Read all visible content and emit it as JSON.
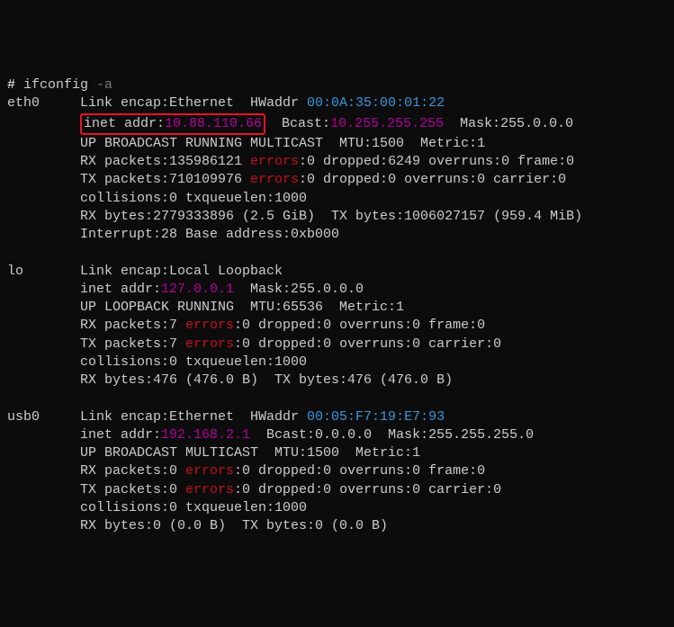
{
  "prompt": "# ",
  "command": "ifconfig",
  "command_arg": " -a",
  "eth0": {
    "name": "eth0",
    "link_prefix": "Link encap:Ethernet  HWaddr ",
    "hwaddr": "00:0A:35:00:01:22",
    "inet_label": "inet addr:",
    "inet": "10.88.110.66",
    "bcast_label": "  Bcast:",
    "bcast": "10.255.255.255",
    "mask": "  Mask:255.0.0.0",
    "flags": "UP BROADCAST RUNNING MULTICAST  MTU:1500  Metric:1",
    "rx_packets_a": "RX packets:135986121 ",
    "rx_err": "errors",
    "rx_packets_b": ":0 dropped:6249 overruns:0 frame:0",
    "tx_packets_a": "TX packets:710109976 ",
    "tx_err": "errors",
    "tx_packets_b": ":0 dropped:0 overruns:0 carrier:0",
    "collisions": "collisions:0 txqueuelen:1000",
    "bytes": "RX bytes:2779333896 (2.5 GiB)  TX bytes:1006027157 (959.4 MiB)",
    "interrupt": "Interrupt:28 Base address:0xb000"
  },
  "lo": {
    "name": "lo",
    "link_prefix": "Link encap:Local Loopback",
    "inet_label": "inet addr:",
    "inet": "127.0.0.1",
    "mask": "  Mask:255.0.0.0",
    "flags": "UP LOOPBACK RUNNING  MTU:65536  Metric:1",
    "rx_packets_a": "RX packets:7 ",
    "rx_err": "errors",
    "rx_packets_b": ":0 dropped:0 overruns:0 frame:0",
    "tx_packets_a": "TX packets:7 ",
    "tx_err": "errors",
    "tx_packets_b": ":0 dropped:0 overruns:0 carrier:0",
    "collisions": "collisions:0 txqueuelen:1000",
    "bytes": "RX bytes:476 (476.0 B)  TX bytes:476 (476.0 B)"
  },
  "usb0": {
    "name": "usb0",
    "link_prefix": "Link encap:Ethernet  HWaddr ",
    "hwaddr": "00:05:F7:19:E7:93",
    "inet_label": "inet addr:",
    "inet": "192.168.2.1",
    "bcast_label": "  Bcast:0.0.0.0  Mask:255.255.255.0",
    "flags": "UP BROADCAST MULTICAST  MTU:1500  Metric:1",
    "rx_packets_a": "RX packets:0 ",
    "rx_err": "errors",
    "rx_packets_b": ":0 dropped:0 overruns:0 frame:0",
    "tx_packets_a": "TX packets:0 ",
    "tx_err": "errors",
    "tx_packets_b": ":0 dropped:0 overruns:0 carrier:0",
    "collisions": "collisions:0 txqueuelen:1000",
    "bytes": "RX bytes:0 (0.0 B)  TX bytes:0 (0.0 B)"
  }
}
